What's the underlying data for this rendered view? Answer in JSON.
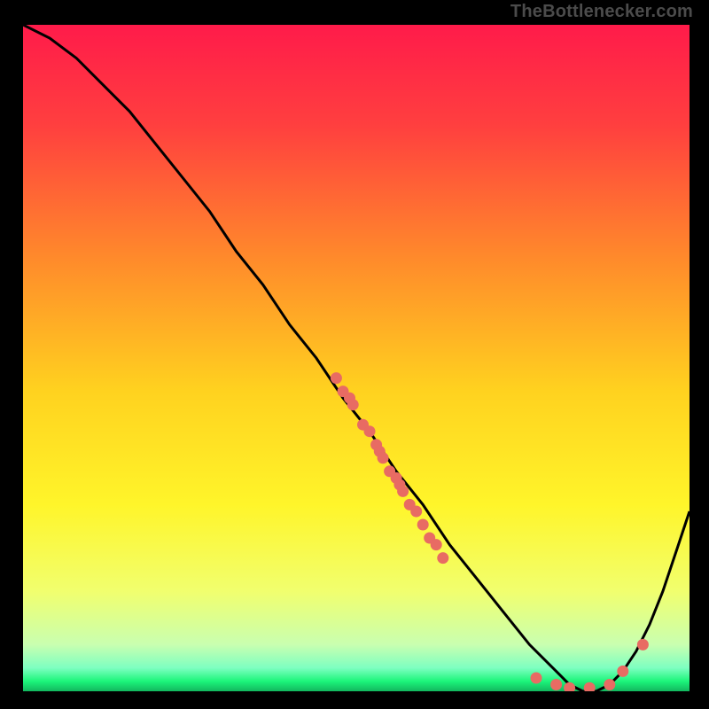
{
  "attribution": "TheBottlenecker.com",
  "chart_data": {
    "type": "line",
    "title": "",
    "xlabel": "",
    "ylabel": "",
    "xlim": [
      0,
      100
    ],
    "ylim": [
      0,
      100
    ],
    "background": "rainbow-gradient-red-to-green",
    "grid": false,
    "series": [
      {
        "name": "curve",
        "x": [
          0,
          4,
          8,
          12,
          16,
          20,
          24,
          28,
          32,
          36,
          40,
          44,
          48,
          52,
          56,
          60,
          64,
          68,
          72,
          76,
          80,
          82,
          84,
          86,
          88,
          90,
          92,
          94,
          96,
          98,
          100
        ],
        "y": [
          100,
          98,
          95,
          91,
          87,
          82,
          77,
          72,
          66,
          61,
          55,
          50,
          44,
          39,
          33,
          28,
          22,
          17,
          12,
          7,
          3,
          1,
          0,
          0,
          1,
          3,
          6,
          10,
          15,
          21,
          27
        ]
      }
    ],
    "points": [
      {
        "x": 47,
        "y": 47
      },
      {
        "x": 48,
        "y": 45
      },
      {
        "x": 49,
        "y": 44
      },
      {
        "x": 49.5,
        "y": 43
      },
      {
        "x": 51,
        "y": 40
      },
      {
        "x": 52,
        "y": 39
      },
      {
        "x": 53,
        "y": 37
      },
      {
        "x": 53.5,
        "y": 36
      },
      {
        "x": 54,
        "y": 35
      },
      {
        "x": 55,
        "y": 33
      },
      {
        "x": 56,
        "y": 32
      },
      {
        "x": 56.5,
        "y": 31
      },
      {
        "x": 57,
        "y": 30
      },
      {
        "x": 58,
        "y": 28
      },
      {
        "x": 59,
        "y": 27
      },
      {
        "x": 60,
        "y": 25
      },
      {
        "x": 61,
        "y": 23
      },
      {
        "x": 62,
        "y": 22
      },
      {
        "x": 63,
        "y": 20
      },
      {
        "x": 77,
        "y": 2
      },
      {
        "x": 80,
        "y": 1
      },
      {
        "x": 82,
        "y": 0.5
      },
      {
        "x": 85,
        "y": 0.5
      },
      {
        "x": 88,
        "y": 1
      },
      {
        "x": 90,
        "y": 3
      },
      {
        "x": 93,
        "y": 7
      }
    ],
    "colors": {
      "curve": "#000000",
      "points": "#e86b63",
      "gradient_stops": [
        {
          "offset": 0.0,
          "color": "#ff1b4a"
        },
        {
          "offset": 0.15,
          "color": "#ff3f3f"
        },
        {
          "offset": 0.35,
          "color": "#ff8a2b"
        },
        {
          "offset": 0.55,
          "color": "#ffd21f"
        },
        {
          "offset": 0.72,
          "color": "#fff52a"
        },
        {
          "offset": 0.85,
          "color": "#f1ff6e"
        },
        {
          "offset": 0.93,
          "color": "#c9ffb0"
        },
        {
          "offset": 0.965,
          "color": "#7dffc1"
        },
        {
          "offset": 0.985,
          "color": "#1cf57a"
        },
        {
          "offset": 1.0,
          "color": "#12b75e"
        }
      ]
    }
  }
}
